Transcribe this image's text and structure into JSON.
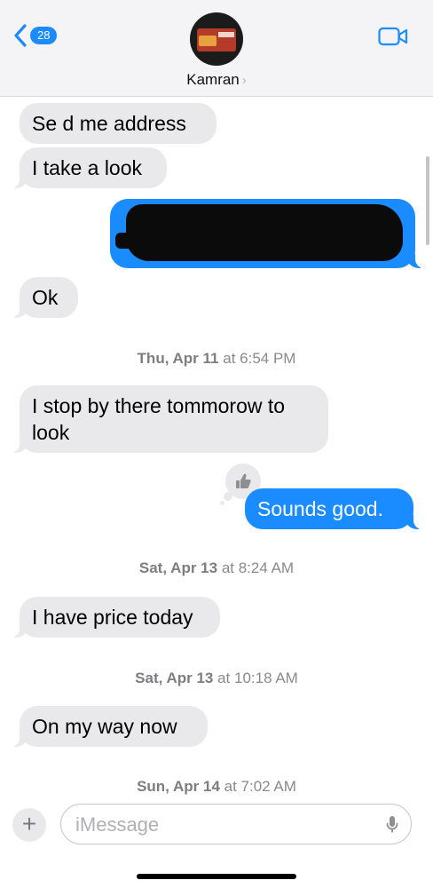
{
  "header": {
    "back_count": "28",
    "contact_name": "Kamran",
    "contact_chevron": "›"
  },
  "messages": [
    {
      "direction": "in",
      "text": "Se d me address"
    },
    {
      "direction": "in",
      "text": "I take a look"
    },
    {
      "direction": "out",
      "text": "",
      "redacted": true
    },
    {
      "direction": "in",
      "text": "Ok"
    },
    {
      "direction": "in",
      "text": "I stop by there tommorow to look"
    },
    {
      "direction": "out",
      "text": "Sounds good.",
      "reaction": "thumbs-up-icon"
    },
    {
      "direction": "in",
      "text": "I have price today"
    },
    {
      "direction": "in",
      "text": "On my way now"
    }
  ],
  "timestamps": [
    {
      "day": "Thu, Apr 11",
      "time": "at 6:54 PM"
    },
    {
      "day": "Sat, Apr 13",
      "time": "at 8:24 AM"
    },
    {
      "day": "Sat, Apr 13",
      "time": "at 10:18 AM"
    },
    {
      "day": "Sun, Apr 14",
      "time": "at 7:02 AM"
    }
  ],
  "composer": {
    "plus_label": "+",
    "placeholder": "iMessage"
  },
  "colors": {
    "outgoing": "#1a8cff",
    "incoming": "#e9e9eb",
    "timestamp": "#8a8a8e"
  },
  "icons": [
    "back-chevron-icon",
    "video-call-icon",
    "thumbs-up-icon",
    "microphone-icon"
  ]
}
